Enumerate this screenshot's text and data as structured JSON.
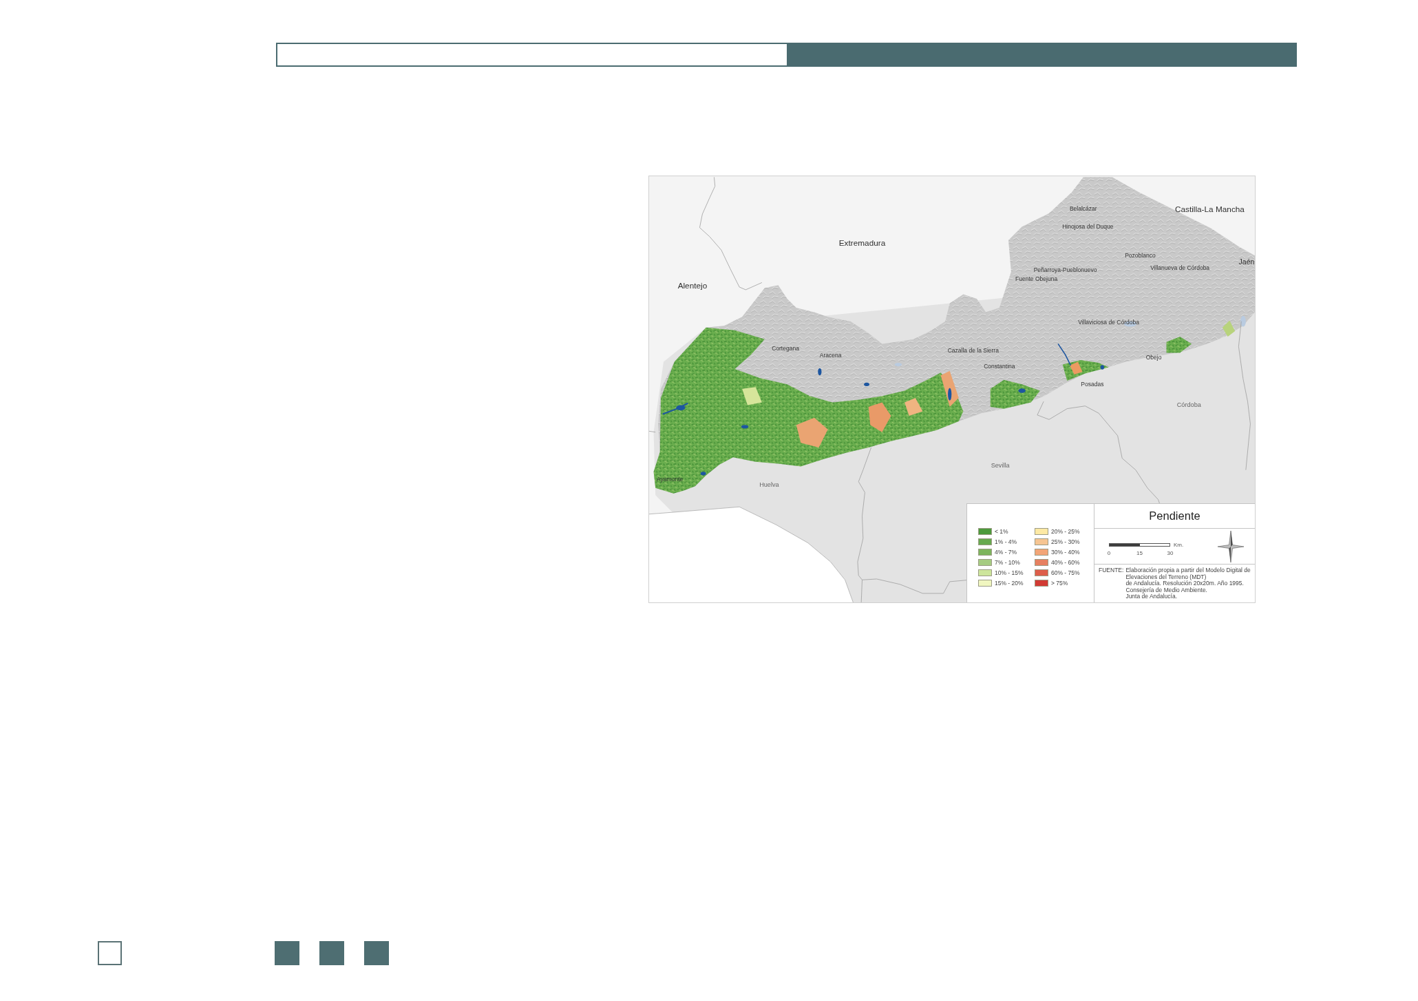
{
  "map": {
    "region_labels": [
      "Castilla-La Mancha",
      "Extremadura",
      "Jaén",
      "Alentejo",
      "Córdoba",
      "Sevilla",
      "Huelva"
    ],
    "town_labels": [
      "Belalcázar",
      "Hinojosa del Duque",
      "Pozoblanco",
      "Villanueva de Córdoba",
      "Peñarroya-Pueblonuevo",
      "Fuente Obejuna",
      "Villaviciosa de Córdoba",
      "Cortegana",
      "Cazalla de la Sierra",
      "Aracena",
      "Obejo",
      "Constantina",
      "Posadas",
      "Ayamonte"
    ],
    "legend": {
      "title": "Pendiente",
      "classes": [
        {
          "label": "< 1%",
          "color": "#4c9a3c"
        },
        {
          "label": "1% - 4%",
          "color": "#67a94f"
        },
        {
          "label": "4% - 7%",
          "color": "#7db45d"
        },
        {
          "label": "7% - 10%",
          "color": "#a6cc82"
        },
        {
          "label": "10% - 15%",
          "color": "#cde59c"
        },
        {
          "label": "15% - 20%",
          "color": "#f0f6c0"
        },
        {
          "label": "20% - 25%",
          "color": "#fde9a4"
        },
        {
          "label": "25% - 30%",
          "color": "#f6c592"
        },
        {
          "label": "30% - 40%",
          "color": "#f2a577"
        },
        {
          "label": "40% - 60%",
          "color": "#e68060"
        },
        {
          "label": "60% - 75%",
          "color": "#dd5e4a"
        },
        {
          "label": "> 75%",
          "color": "#d13a33"
        }
      ],
      "scale_bar": {
        "ticks": [
          "0",
          "15",
          "30"
        ],
        "unit": "Km."
      },
      "source": {
        "label": "FUENTE:",
        "lines": [
          "Elaboración propia a partir del Modelo Digital de",
          "Elevaciones del Terreno (MDT)",
          "de Andalucía. Resolución 20x20m. Año 1995.",
          "Consejería de Medio Ambiente.",
          "Junta de Andalucía."
        ]
      }
    }
  }
}
